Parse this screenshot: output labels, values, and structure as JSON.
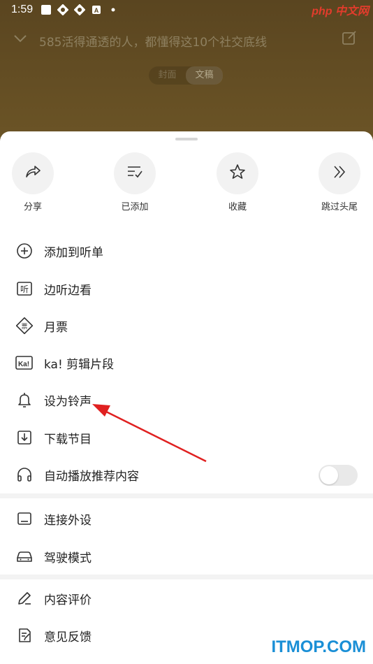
{
  "status_bar": {
    "time": "1:59",
    "watermark": "php 中文网"
  },
  "header": {
    "title": "585活得通透的人，都懂得这10个社交底线"
  },
  "segment": {
    "items": [
      "封面",
      "文稿"
    ],
    "active": 1
  },
  "actions": [
    {
      "label": "分享",
      "icon": "share-icon"
    },
    {
      "label": "已添加",
      "icon": "added-list-icon"
    },
    {
      "label": "收藏",
      "icon": "star-icon"
    },
    {
      "label": "跳过头尾",
      "icon": "skip-forward-icon"
    }
  ],
  "menu": [
    {
      "label": "添加到听单",
      "icon": "plus-circle-icon"
    },
    {
      "label": "边听边看",
      "icon": "listen-read-icon"
    },
    {
      "label": "月票",
      "icon": "ticket-icon"
    },
    {
      "label": "ka! 剪辑片段",
      "icon": "ka-clip-icon"
    },
    {
      "label": "设为铃声",
      "icon": "bell-icon"
    },
    {
      "label": "下载节目",
      "icon": "download-icon"
    },
    {
      "label": "自动播放推荐内容",
      "icon": "headphones-icon",
      "toggle": false
    },
    {
      "label": "连接外设",
      "icon": "device-icon"
    },
    {
      "label": "驾驶模式",
      "icon": "car-icon"
    },
    {
      "label": "内容评价",
      "icon": "pen-icon"
    },
    {
      "label": "意见反馈",
      "icon": "feedback-icon"
    }
  ],
  "footer_watermark": "ITMOP.COM",
  "colors": {
    "accent_arrow": "#e02020",
    "sheet_bg": "#ffffff",
    "top_bg": "#5e4a22"
  }
}
